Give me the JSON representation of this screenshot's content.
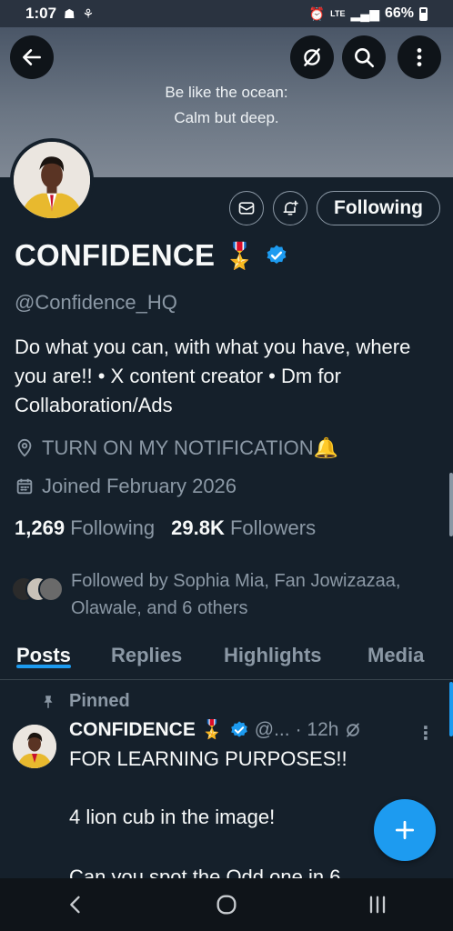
{
  "status": {
    "time": "1:07",
    "network": "LTE",
    "battery": "66%"
  },
  "banner": {
    "line1": "Be like the ocean:",
    "line2": "Calm but deep."
  },
  "actions": {
    "following_label": "Following"
  },
  "profile": {
    "name": "CONFIDENCE",
    "name_emoji": "🎖️",
    "handle": "@Confidence_HQ",
    "bio": "Do what you can, with what you have, where you are!! • X content creator • Dm for Collaboration/Ads",
    "location": "TURN ON MY NOTIFICATION🔔",
    "joined": "Joined February 2026",
    "following_count": "1,269",
    "following_label": "Following",
    "followers_count": "29.8K",
    "followers_label": "Followers",
    "followed_by": "Followed by Sophia Mia, Fan Jowizazaa, Olawale, and 6 others"
  },
  "tabs": [
    "Posts",
    "Replies",
    "Highlights",
    "Media"
  ],
  "post": {
    "pinned_label": "Pinned",
    "author": "CONFIDENCE",
    "handle_short": "@...",
    "time": "· 12h",
    "line1": "FOR LEARNING PURPOSES!!",
    "line2": "4 lion cub in the image!",
    "line3": "Can you spot the Odd one in 6"
  },
  "icons": [
    "back-arrow-icon",
    "no-grok-icon",
    "search-icon",
    "more-vertical-icon",
    "mail-icon",
    "bell-plus-icon",
    "verified-badge-icon",
    "location-pin-icon",
    "calendar-icon",
    "pin-icon",
    "plus-icon"
  ],
  "colors": {
    "accent": "#1d9bf0",
    "background": "#15202b",
    "muted": "#8b98a5"
  }
}
